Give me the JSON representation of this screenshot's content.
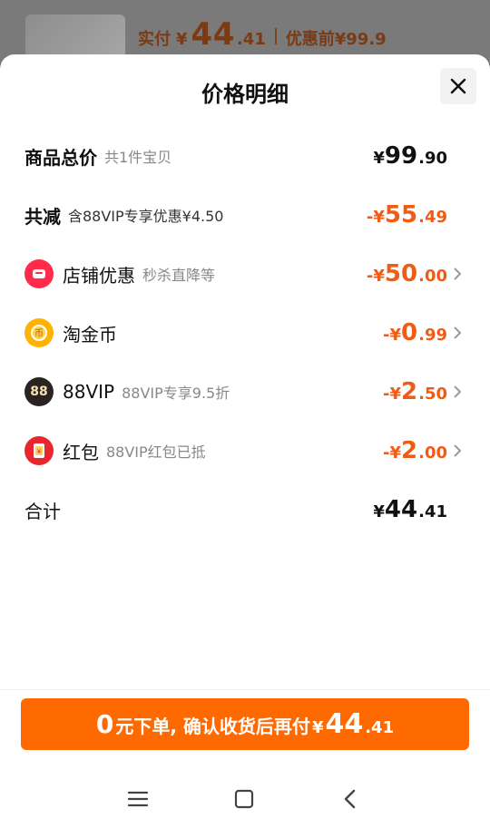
{
  "top_summary": {
    "label": "实付",
    "currency": "¥",
    "amount_int": "44",
    "amount_dec": ".41",
    "before_label": "优惠前¥99.9"
  },
  "sheet": {
    "title": "价格明细",
    "close_icon": "close-icon"
  },
  "rows": {
    "total": {
      "title": "商品总价",
      "sub": "共1件宝贝",
      "pre": "¥",
      "int": "99",
      "dec": ".90"
    },
    "reduce": {
      "title": "共减",
      "sub": "含88VIP专享优惠¥4.50",
      "pre": "-¥",
      "int": "55",
      "dec": ".49"
    },
    "shop": {
      "title": "店铺优惠",
      "sub": "秒杀直降等",
      "pre": "-¥",
      "int": "50",
      "dec": ".00",
      "icon": "shop-discount-icon"
    },
    "coins": {
      "title": "淘金币",
      "sub": "",
      "pre": "-¥",
      "int": "0",
      "dec": ".99",
      "icon": "gold-coin-icon"
    },
    "vip": {
      "title": "88VIP",
      "sub": "88VIP专享9.5折",
      "pre": "-¥",
      "int": "2",
      "dec": ".50",
      "icon": "88-badge-icon",
      "badge_text": "88"
    },
    "redpacket": {
      "title": "红包",
      "sub": "88VIP红包已抵",
      "pre": "-¥",
      "int": "2",
      "dec": ".00",
      "icon": "red-packet-icon"
    },
    "sum": {
      "title": "合计",
      "pre": "¥",
      "int": "44",
      "dec": ".41"
    }
  },
  "pay_button": {
    "zero": "0",
    "text": "元下单, 确认收货后再付",
    "yen": "¥",
    "int": "44",
    "dec": ".41"
  },
  "nav": {
    "menu_icon": "menu-icon",
    "home_icon": "home-square-icon",
    "back_icon": "back-chevron-icon"
  },
  "colors": {
    "accent": "#ff6a00",
    "discount_text": "#f05c16",
    "shop_icon_red": "#ff2b4a",
    "coin_yellow": "#ffb300",
    "vip_dark": "#2a2321",
    "redpacket_red": "#e8262e"
  }
}
